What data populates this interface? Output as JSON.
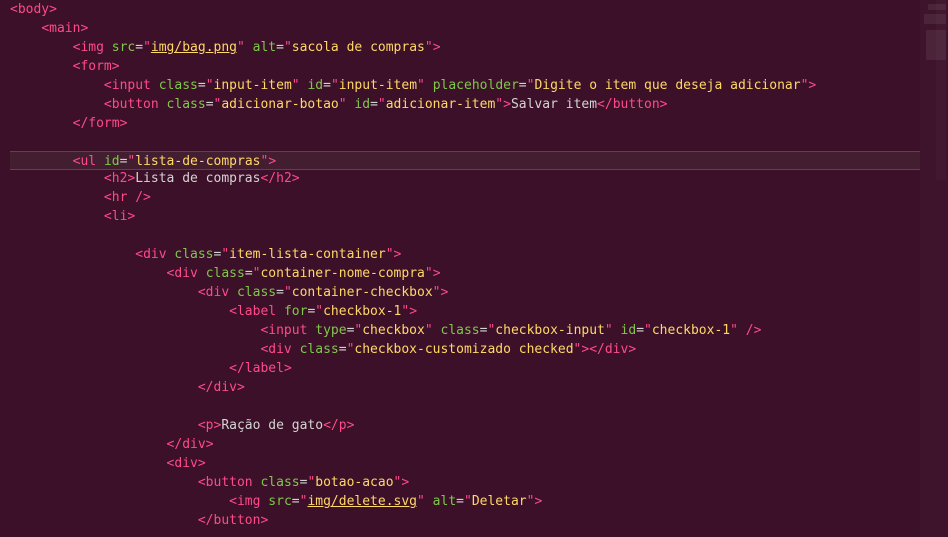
{
  "code": {
    "lines": [
      {
        "indent": 0,
        "type": "open",
        "tag": "body"
      },
      {
        "indent": 1,
        "type": "open",
        "tag": "main"
      },
      {
        "indent": 2,
        "type": "self",
        "tag": "img",
        "attrs": [
          [
            "src",
            "img/bag.png",
            "u"
          ],
          [
            "alt",
            "sacola de compras"
          ]
        ]
      },
      {
        "indent": 2,
        "type": "open",
        "tag": "form"
      },
      {
        "indent": 3,
        "type": "self",
        "tag": "input",
        "attrs": [
          [
            "class",
            "input-item"
          ],
          [
            "id",
            "input-item"
          ],
          [
            "placeholder",
            "Digite o item que deseja adicionar"
          ]
        ]
      },
      {
        "indent": 3,
        "type": "pair",
        "tag": "button",
        "attrs": [
          [
            "class",
            "adicionar-botao"
          ],
          [
            "id",
            "adicionar-item"
          ]
        ],
        "text": "Salvar item"
      },
      {
        "indent": 2,
        "type": "close",
        "tag": "form"
      },
      {
        "indent": 0,
        "type": "blank"
      },
      {
        "indent": 2,
        "type": "open",
        "tag": "ul",
        "attrs": [
          [
            "id",
            "lista-de-compras"
          ]
        ],
        "hl": true
      },
      {
        "indent": 3,
        "type": "pair",
        "tag": "h2",
        "text": "Lista de compras"
      },
      {
        "indent": 3,
        "type": "self",
        "tag": "hr",
        "slash": true
      },
      {
        "indent": 3,
        "type": "open",
        "tag": "li"
      },
      {
        "indent": 0,
        "type": "blank"
      },
      {
        "indent": 4,
        "type": "open",
        "tag": "div",
        "attrs": [
          [
            "class",
            "item-lista-container"
          ]
        ]
      },
      {
        "indent": 5,
        "type": "open",
        "tag": "div",
        "attrs": [
          [
            "class",
            "container-nome-compra"
          ]
        ]
      },
      {
        "indent": 6,
        "type": "open",
        "tag": "div",
        "attrs": [
          [
            "class",
            "container-checkbox"
          ]
        ]
      },
      {
        "indent": 7,
        "type": "open",
        "tag": "label",
        "attrs": [
          [
            "for",
            "checkbox-1"
          ]
        ]
      },
      {
        "indent": 8,
        "type": "self",
        "tag": "input",
        "attrs": [
          [
            "type",
            "checkbox"
          ],
          [
            "class",
            "checkbox-input"
          ],
          [
            "id",
            "checkbox-1"
          ]
        ],
        "slash": true
      },
      {
        "indent": 8,
        "type": "pair",
        "tag": "div",
        "attrs": [
          [
            "class",
            "checkbox-customizado checked"
          ]
        ],
        "text": ""
      },
      {
        "indent": 7,
        "type": "close",
        "tag": "label"
      },
      {
        "indent": 6,
        "type": "close",
        "tag": "div"
      },
      {
        "indent": 0,
        "type": "blank"
      },
      {
        "indent": 6,
        "type": "pair",
        "tag": "p",
        "text": "Ração de gato"
      },
      {
        "indent": 5,
        "type": "close",
        "tag": "div"
      },
      {
        "indent": 5,
        "type": "open",
        "tag": "div"
      },
      {
        "indent": 6,
        "type": "open",
        "tag": "button",
        "attrs": [
          [
            "class",
            "botao-acao"
          ]
        ]
      },
      {
        "indent": 7,
        "type": "self",
        "tag": "img",
        "attrs": [
          [
            "src",
            "img/delete.svg",
            "u"
          ],
          [
            "alt",
            "Deletar"
          ]
        ]
      },
      {
        "indent": 6,
        "type": "close",
        "tag": "button"
      }
    ]
  }
}
